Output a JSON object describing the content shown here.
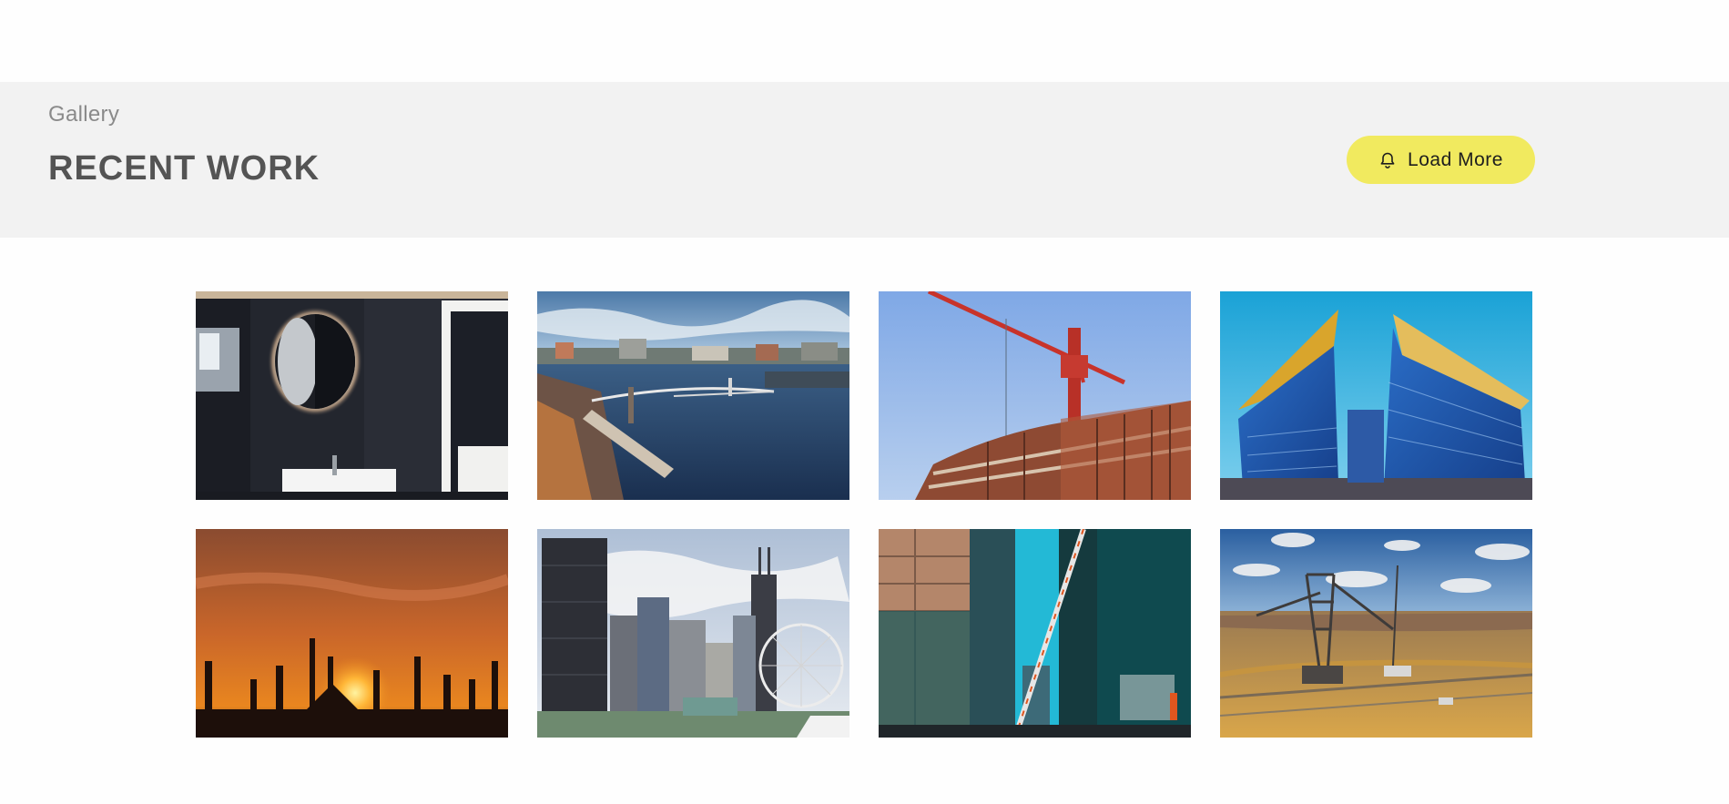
{
  "header": {
    "eyebrow": "Gallery",
    "title": "RECENT WORK",
    "load_more_label": "Load More",
    "load_more_icon": "bell-icon",
    "load_more_color": "#f1ea5f"
  },
  "gallery": {
    "items": [
      {
        "name": "gallery-image-bathroom-mirror"
      },
      {
        "name": "gallery-image-riverside-city"
      },
      {
        "name": "gallery-image-construction-crane"
      },
      {
        "name": "gallery-image-glass-office-buildings"
      },
      {
        "name": "gallery-image-sunset-construction-silhouette"
      },
      {
        "name": "gallery-image-chicago-skyline-ferris-wheel"
      },
      {
        "name": "gallery-image-street-crane-skyscrapers"
      },
      {
        "name": "gallery-image-mining-excavator"
      }
    ]
  }
}
